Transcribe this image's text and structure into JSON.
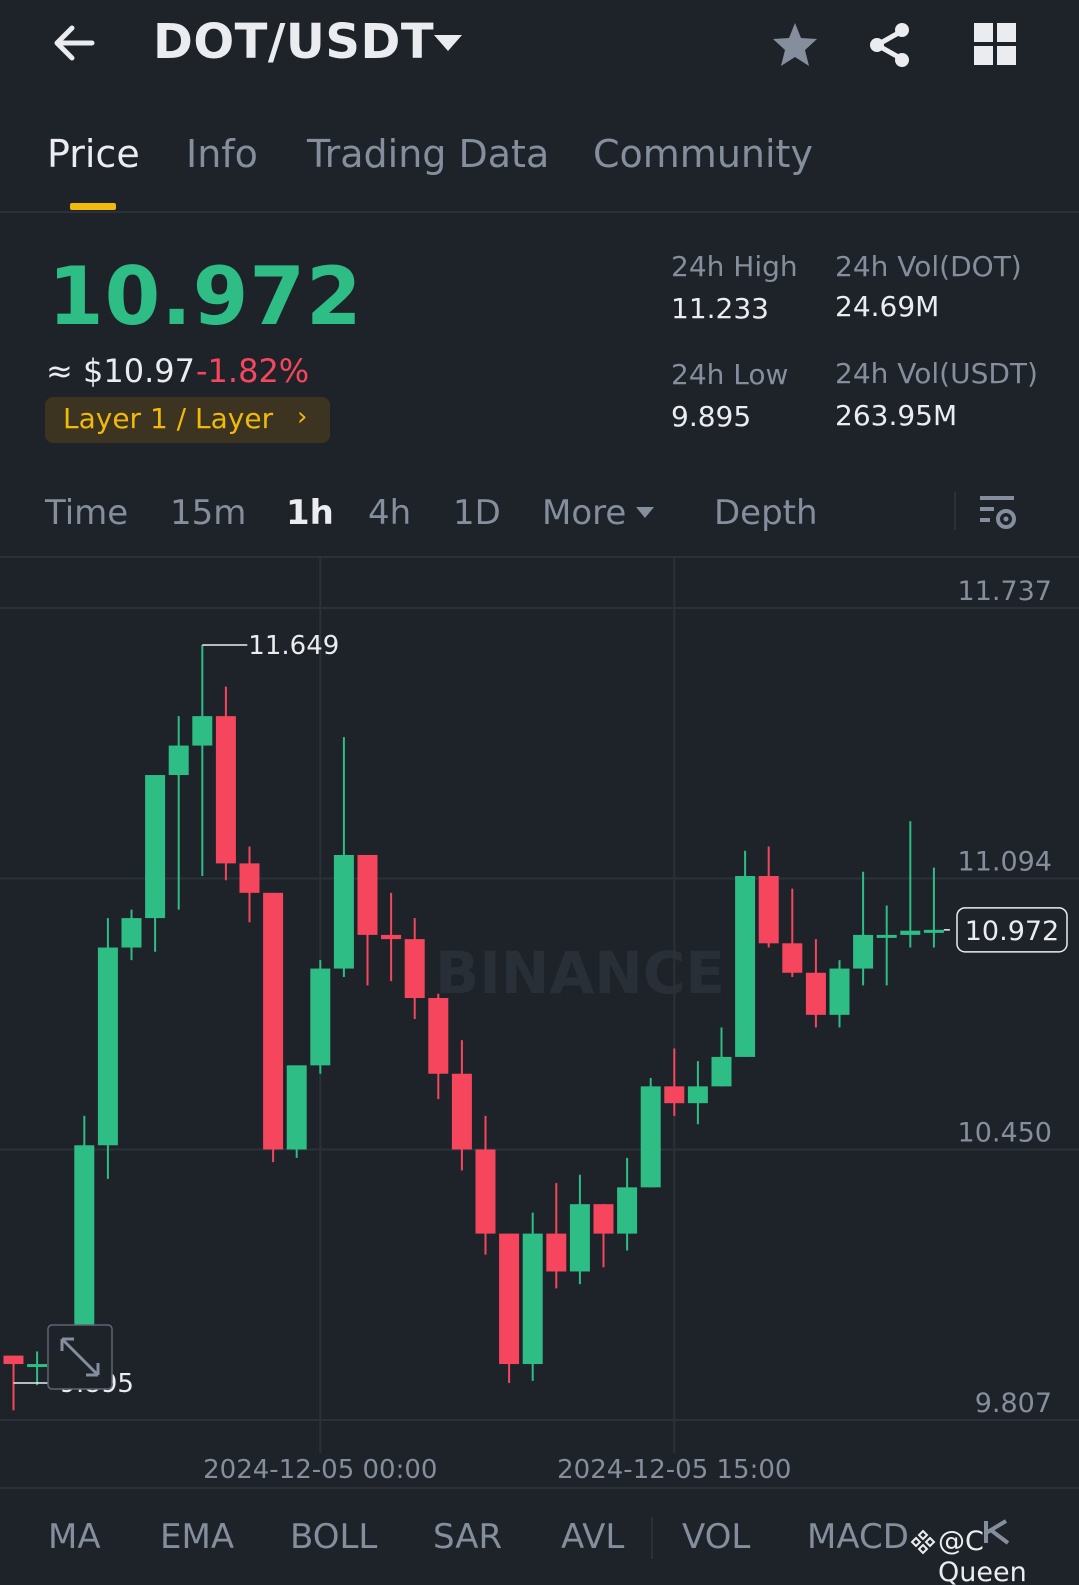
{
  "header": {
    "pair": "DOT/USDT",
    "icons": [
      "back-arrow-icon",
      "caret-down-icon",
      "star-icon",
      "share-icon",
      "grid-menu-icon"
    ]
  },
  "tabs": [
    {
      "label": "Price",
      "active": true
    },
    {
      "label": "Info",
      "active": false
    },
    {
      "label": "Trading Data",
      "active": false
    },
    {
      "label": "Community",
      "active": false
    }
  ],
  "price": {
    "last": "10.972",
    "approx_usd": "≈ $10.97",
    "change_pct": "-1.82%",
    "tag": "Layer 1 / Layer",
    "tag_arrow": "›"
  },
  "stats": {
    "high_label": "24h High",
    "high_value": "11.233",
    "low_label": "24h Low",
    "low_value": "9.895",
    "vol_base_label": "24h Vol(DOT)",
    "vol_base_value": "24.69M",
    "vol_quote_label": "24h Vol(USDT)",
    "vol_quote_value": "263.95M"
  },
  "intervals": {
    "items": [
      "Time",
      "15m",
      "1h",
      "4h",
      "1D",
      "More"
    ],
    "active": "1h",
    "depth": "Depth"
  },
  "indicators": [
    "MA",
    "EMA",
    "BOLL",
    "SAR",
    "AVL",
    "VOL",
    "MACD"
  ],
  "watermark": {
    "brand": "BINANCE",
    "user": "@C Queen"
  },
  "colors": {
    "up": "#2ebd85",
    "down": "#f6465d",
    "accent": "#f0b90b",
    "bg": "#1e2329",
    "muted": "#848e9c"
  },
  "chart_data": {
    "type": "candlestick",
    "y_ticks": [
      "11.737",
      "11.094",
      "10.450",
      "9.807"
    ],
    "ylim": [
      9.807,
      11.737
    ],
    "x_ticks": [
      {
        "label": "2024-12-05 00:00",
        "candle_index": 13
      },
      {
        "label": "2024-12-05 15:00",
        "candle_index": 28
      }
    ],
    "high_marker": {
      "label": "11.649",
      "value": 11.649
    },
    "low_marker": {
      "label": "9.895",
      "value": 9.895
    },
    "last_price_label": "10.972",
    "last_price": 10.972,
    "candles": [
      {
        "o": 9.96,
        "h": 9.96,
        "c": 9.94,
        "l": 9.83
      },
      {
        "o": 9.94,
        "h": 9.97,
        "c": 9.94,
        "l": 9.89
      },
      {
        "o": 9.94,
        "h": 9.97,
        "c": 9.96,
        "l": 9.93
      },
      {
        "o": 9.96,
        "h": 10.53,
        "c": 10.46,
        "l": 9.96
      },
      {
        "o": 10.46,
        "h": 11.0,
        "c": 10.93,
        "l": 10.38
      },
      {
        "o": 10.93,
        "h": 11.02,
        "c": 11.0,
        "l": 10.9
      },
      {
        "o": 11.0,
        "h": 11.34,
        "c": 11.34,
        "l": 10.92
      },
      {
        "o": 11.34,
        "h": 11.48,
        "c": 11.41,
        "l": 11.02
      },
      {
        "o": 11.41,
        "h": 11.649,
        "c": 11.48,
        "l": 11.1
      },
      {
        "o": 11.48,
        "h": 11.55,
        "c": 11.13,
        "l": 11.09
      },
      {
        "o": 11.13,
        "h": 11.17,
        "c": 11.06,
        "l": 10.99
      },
      {
        "o": 11.06,
        "h": 11.06,
        "c": 10.45,
        "l": 10.42
      },
      {
        "o": 10.45,
        "h": 10.62,
        "c": 10.65,
        "l": 10.43
      },
      {
        "o": 10.65,
        "h": 10.9,
        "c": 10.88,
        "l": 10.63
      },
      {
        "o": 10.88,
        "h": 11.43,
        "c": 11.15,
        "l": 10.86
      },
      {
        "o": 11.15,
        "h": 11.12,
        "c": 10.96,
        "l": 10.84
      },
      {
        "o": 10.96,
        "h": 11.06,
        "c": 10.95,
        "l": 10.85
      },
      {
        "o": 10.95,
        "h": 11.0,
        "c": 10.81,
        "l": 10.76
      },
      {
        "o": 10.81,
        "h": 10.82,
        "c": 10.63,
        "l": 10.57
      },
      {
        "o": 10.63,
        "h": 10.71,
        "c": 10.45,
        "l": 10.4
      },
      {
        "o": 10.45,
        "h": 10.53,
        "c": 10.25,
        "l": 10.2
      },
      {
        "o": 10.25,
        "h": 10.25,
        "c": 9.94,
        "l": 9.895
      },
      {
        "o": 9.94,
        "h": 10.3,
        "c": 10.25,
        "l": 9.9
      },
      {
        "o": 10.25,
        "h": 10.37,
        "c": 10.16,
        "l": 10.12
      },
      {
        "o": 10.16,
        "h": 10.39,
        "c": 10.32,
        "l": 10.13
      },
      {
        "o": 10.32,
        "h": 10.32,
        "c": 10.25,
        "l": 10.17
      },
      {
        "o": 10.25,
        "h": 10.43,
        "c": 10.36,
        "l": 10.21
      },
      {
        "o": 10.36,
        "h": 10.62,
        "c": 10.6,
        "l": 10.36
      },
      {
        "o": 10.6,
        "h": 10.69,
        "c": 10.56,
        "l": 10.53
      },
      {
        "o": 10.56,
        "h": 10.66,
        "c": 10.6,
        "l": 10.51
      },
      {
        "o": 10.6,
        "h": 10.74,
        "c": 10.67,
        "l": 10.6
      },
      {
        "o": 10.67,
        "h": 11.16,
        "c": 11.1,
        "l": 10.67
      },
      {
        "o": 11.1,
        "h": 11.17,
        "c": 10.94,
        "l": 10.93
      },
      {
        "o": 10.94,
        "h": 11.07,
        "c": 10.87,
        "l": 10.86
      },
      {
        "o": 10.87,
        "h": 10.95,
        "c": 10.77,
        "l": 10.74
      },
      {
        "o": 10.77,
        "h": 10.9,
        "c": 10.88,
        "l": 10.74
      },
      {
        "o": 10.88,
        "h": 11.11,
        "c": 10.96,
        "l": 10.84
      },
      {
        "o": 10.96,
        "h": 11.03,
        "c": 10.96,
        "l": 10.84
      },
      {
        "o": 10.96,
        "h": 11.23,
        "c": 10.97,
        "l": 10.93
      },
      {
        "o": 10.97,
        "h": 11.12,
        "c": 10.972,
        "l": 10.93
      }
    ]
  }
}
